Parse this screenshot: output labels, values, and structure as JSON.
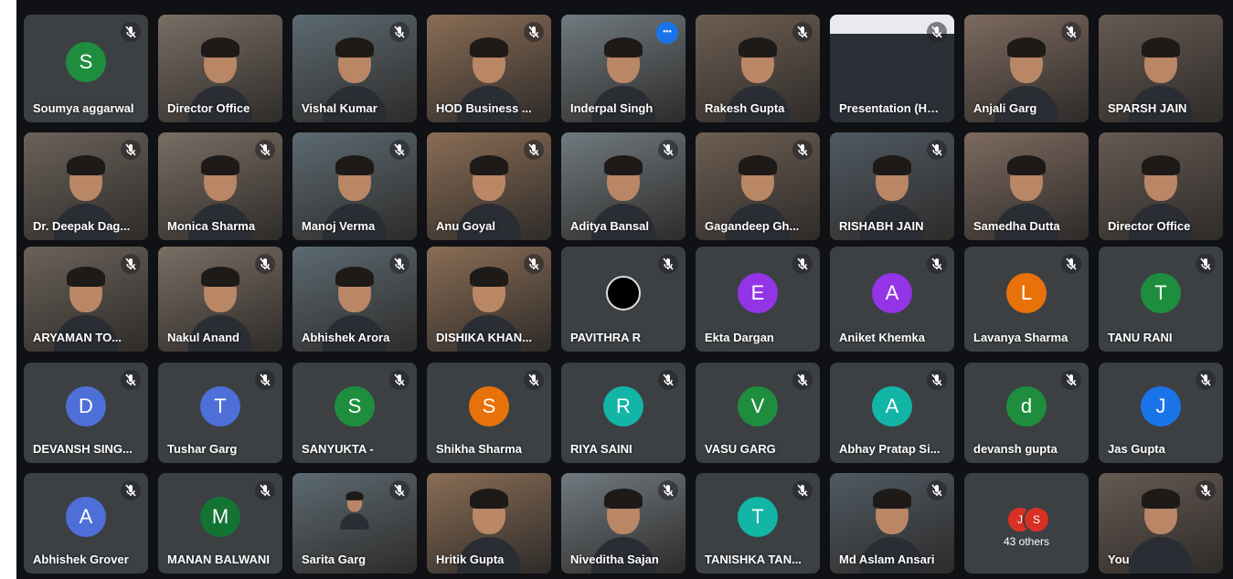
{
  "colors": {
    "frame_bg": "#0f1114",
    "tile_bg": "#3c4043",
    "active_speaker": "#8ab4f8",
    "more_button": "#1a73e8"
  },
  "participants": [
    {
      "name": "Soumya aggarwal",
      "type": "avatar",
      "initial": "S",
      "color": "#1e8e3e",
      "muted": true
    },
    {
      "name": "Director Office",
      "type": "video",
      "muted": false
    },
    {
      "name": "Vishal Kumar",
      "type": "video",
      "muted": true
    },
    {
      "name": "HOD Business ...",
      "type": "video",
      "muted": true
    },
    {
      "name": "Inderpal Singh",
      "type": "video",
      "muted": false,
      "active": true
    },
    {
      "name": "Rakesh Gupta",
      "type": "video",
      "muted": true
    },
    {
      "name": "Presentation (HOD Business ...",
      "type": "presentation",
      "muted": true
    },
    {
      "name": "Anjali Garg",
      "type": "video",
      "muted": true
    },
    {
      "name": "SPARSH JAIN",
      "type": "video",
      "muted": false
    },
    {
      "name": "Dr. Deepak Dag...",
      "type": "video",
      "muted": true
    },
    {
      "name": "Monica Sharma",
      "type": "video",
      "muted": true
    },
    {
      "name": "Manoj Verma",
      "type": "video",
      "muted": true
    },
    {
      "name": "Anu Goyal",
      "type": "video",
      "muted": true
    },
    {
      "name": "Aditya Bansal",
      "type": "video",
      "muted": true
    },
    {
      "name": "Gagandeep Gh...",
      "type": "video",
      "muted": true
    },
    {
      "name": "RISHABH JAIN",
      "type": "video",
      "muted": true
    },
    {
      "name": "Samedha Dutta",
      "type": "video",
      "muted": false
    },
    {
      "name": "Director Office",
      "type": "video",
      "muted": false
    },
    {
      "name": "ARYAMAN TO...",
      "type": "video",
      "muted": true
    },
    {
      "name": "Nakul Anand",
      "type": "video",
      "muted": true
    },
    {
      "name": "Abhishek Arora",
      "type": "video",
      "muted": true
    },
    {
      "name": "DISHIKA KHAN...",
      "type": "video",
      "muted": true
    },
    {
      "name": "PAVITHRA R",
      "type": "ring",
      "muted": true
    },
    {
      "name": "Ekta Dargan",
      "type": "avatar",
      "initial": "E",
      "color": "#9334e6",
      "muted": true
    },
    {
      "name": "Aniket Khemka",
      "type": "avatar",
      "initial": "A",
      "color": "#9334e6",
      "muted": true
    },
    {
      "name": "Lavanya Sharma",
      "type": "avatar",
      "initial": "L",
      "color": "#e8710a",
      "muted": true
    },
    {
      "name": "TANU RANI",
      "type": "avatar",
      "initial": "T",
      "color": "#1e8e3e",
      "muted": true
    },
    {
      "name": "DEVANSH SING...",
      "type": "avatar",
      "initial": "D",
      "color": "#4e6fd8",
      "muted": true
    },
    {
      "name": "Tushar Garg",
      "type": "avatar",
      "initial": "T",
      "color": "#4e6fd8",
      "muted": true
    },
    {
      "name": "SANYUKTA -",
      "type": "avatar",
      "initial": "S",
      "color": "#1e8e3e",
      "muted": true
    },
    {
      "name": "Shikha Sharma",
      "type": "avatar",
      "initial": "S",
      "color": "#e8710a",
      "muted": true
    },
    {
      "name": "RIYA SAINI",
      "type": "avatar",
      "initial": "R",
      "color": "#12b5a6",
      "muted": true
    },
    {
      "name": "VASU GARG",
      "type": "avatar",
      "initial": "V",
      "color": "#1e8e3e",
      "muted": true
    },
    {
      "name": "Abhay Pratap Si...",
      "type": "avatar",
      "initial": "A",
      "color": "#12b5a6",
      "muted": true
    },
    {
      "name": "devansh gupta",
      "type": "avatar",
      "initial": "d",
      "color": "#1e8e3e",
      "muted": true
    },
    {
      "name": "Jas Gupta",
      "type": "avatar",
      "initial": "J",
      "color": "#1a73e8",
      "muted": true
    },
    {
      "name": "Abhishek Grover",
      "type": "avatar",
      "initial": "A",
      "color": "#4e6fd8",
      "muted": true
    },
    {
      "name": "MANAN BALWANI",
      "type": "avatar",
      "initial": "M",
      "color": "#137333",
      "muted": true
    },
    {
      "name": "Sarita Garg",
      "type": "photo",
      "muted": true
    },
    {
      "name": "Hritik Gupta",
      "type": "video",
      "muted": false
    },
    {
      "name": "Niveditha Sajan",
      "type": "video",
      "muted": true
    },
    {
      "name": "TANISHKA TAN...",
      "type": "avatar",
      "initial": "T",
      "color": "#12b5a6",
      "muted": true
    },
    {
      "name": "Md Aslam Ansari",
      "type": "video",
      "muted": true
    },
    {
      "name": "43 others",
      "type": "others",
      "initials": [
        "J",
        "S"
      ],
      "colors": [
        "#d93025",
        "#d93025"
      ],
      "muted": false
    },
    {
      "name": "You",
      "type": "video",
      "muted": true
    }
  ]
}
